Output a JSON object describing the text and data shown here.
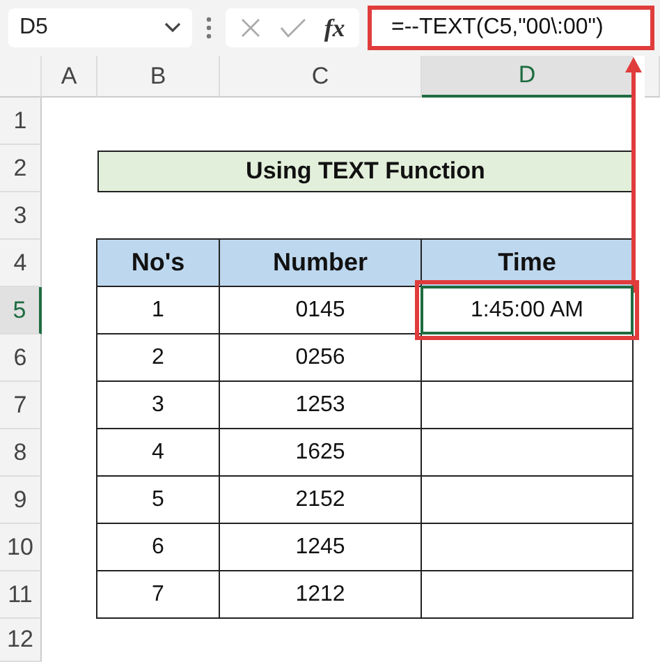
{
  "name_box": {
    "value": "D5"
  },
  "formula_bar": {
    "function_label": "fx",
    "value": "=--TEXT(C5,\"00\\:00\")"
  },
  "columns": [
    {
      "label": "A",
      "selected": false
    },
    {
      "label": "B",
      "selected": false
    },
    {
      "label": "C",
      "selected": false
    },
    {
      "label": "D",
      "selected": true
    }
  ],
  "rows": [
    {
      "label": "1",
      "selected": false
    },
    {
      "label": "2",
      "selected": false
    },
    {
      "label": "3",
      "selected": false
    },
    {
      "label": "4",
      "selected": false
    },
    {
      "label": "5",
      "selected": true
    },
    {
      "label": "6",
      "selected": false
    },
    {
      "label": "7",
      "selected": false
    },
    {
      "label": "8",
      "selected": false
    },
    {
      "label": "9",
      "selected": false
    },
    {
      "label": "10",
      "selected": false
    },
    {
      "label": "11",
      "selected": false
    },
    {
      "label": "12",
      "selected": false
    }
  ],
  "title": "Using TEXT Function",
  "table": {
    "columns": [
      "No's",
      "Number",
      "Time"
    ],
    "rows": [
      {
        "cells": [
          "1",
          "0145",
          "1:45:00 AM"
        ],
        "selected": true
      },
      {
        "cells": [
          "2",
          "0256"
        ],
        "selected": false
      },
      {
        "cells": [
          "3",
          "1253"
        ],
        "selected": false
      },
      {
        "cells": [
          "4",
          "1625"
        ],
        "selected": false
      },
      {
        "cells": [
          "5",
          "2152"
        ],
        "selected": false
      },
      {
        "cells": [
          "6",
          "1245"
        ],
        "selected": false
      },
      {
        "cells": [
          "7",
          "1212"
        ],
        "selected": false
      }
    ]
  }
}
